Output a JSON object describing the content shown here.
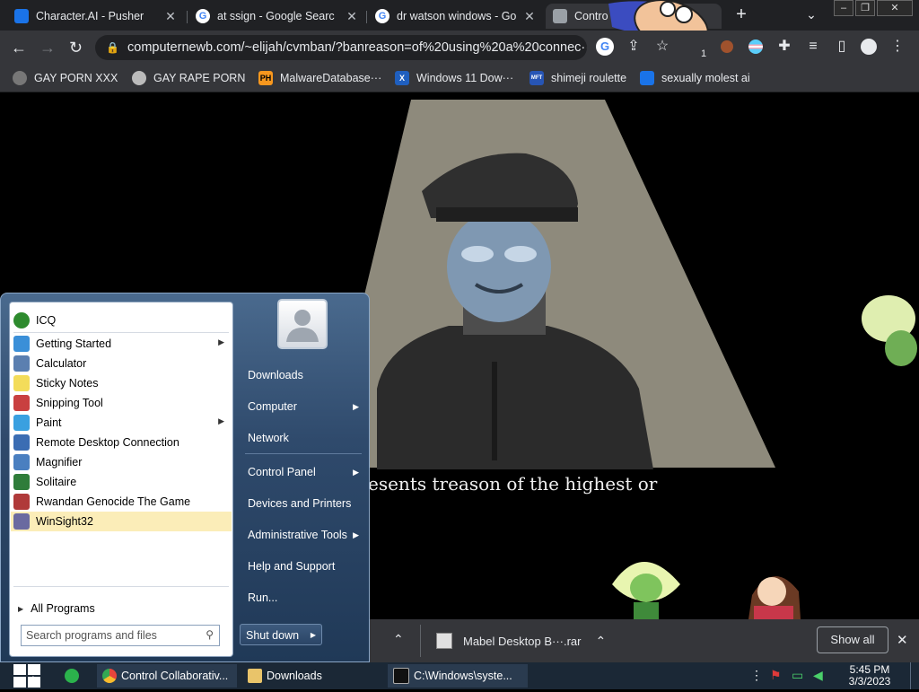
{
  "browser": {
    "tabs": [
      {
        "title": "Character.AI - Pusher",
        "favicon": "character-ai-icon",
        "color": "#1a73e8"
      },
      {
        "title": "at ssign - Google Searc",
        "favicon": "google-icon",
        "color": "#ffffff"
      },
      {
        "title": "dr watson windows - Go",
        "favicon": "google-icon",
        "color": "#ffffff"
      },
      {
        "title": "Contro",
        "favicon": "control-icon",
        "color": "#9aa0a6"
      }
    ],
    "url": "computernewb.com/~elijah/cvmban/?banreason=of%20using%20a%20connec···",
    "extension_badge": "1",
    "bookmarks": [
      {
        "label": "GAY PORN XXX",
        "icon": "gear-bookmark-icon"
      },
      {
        "label": "GAY RAPE PORN",
        "icon": "globe-icon"
      },
      {
        "label": "MalwareDatabase···",
        "icon": "ph-icon",
        "icon_text": "PH"
      },
      {
        "label": "Windows 11 Dow···",
        "icon": "x-icon",
        "icon_text": "X"
      },
      {
        "label": "shimeji roulette",
        "icon": "mft-icon",
        "icon_text": "MFT"
      },
      {
        "label": "sexually molest ai",
        "icon": "character-ai-icon"
      }
    ]
  },
  "page": {
    "subtitle": "esents treason of the highest or"
  },
  "start_menu": {
    "programs": [
      {
        "label": "ICQ",
        "icon": "icq-icon",
        "color": "#2e8b2e",
        "has_submenu": false
      },
      {
        "label": "Getting Started",
        "icon": "getting-started-icon",
        "color": "#3a8fd8",
        "has_submenu": true
      },
      {
        "label": "Calculator",
        "icon": "calculator-icon",
        "color": "#5b7fb0",
        "has_submenu": false
      },
      {
        "label": "Sticky Notes",
        "icon": "sticky-notes-icon",
        "color": "#f3dc5a",
        "has_submenu": false
      },
      {
        "label": "Snipping Tool",
        "icon": "snipping-tool-icon",
        "color": "#c94040",
        "has_submenu": false
      },
      {
        "label": "Paint",
        "icon": "paint-icon",
        "color": "#3aa0e0",
        "has_submenu": true
      },
      {
        "label": "Remote Desktop Connection",
        "icon": "remote-desktop-icon",
        "color": "#3b6db3",
        "has_submenu": false
      },
      {
        "label": "Magnifier",
        "icon": "magnifier-icon",
        "color": "#4a7fc0",
        "has_submenu": false
      },
      {
        "label": "Solitaire",
        "icon": "solitaire-icon",
        "color": "#2f7d3a",
        "has_submenu": false
      },
      {
        "label": "Rwandan Genocide The Game",
        "icon": "game-icon",
        "color": "#b03a3a",
        "has_submenu": false
      },
      {
        "label": "WinSight32",
        "icon": "winsight-icon",
        "color": "#6a6aa0",
        "has_submenu": false,
        "highlighted": true
      }
    ],
    "all_programs": "All Programs",
    "search_placeholder": "Search programs and files",
    "right_links": [
      {
        "label": "Downloads",
        "has_submenu": false
      },
      {
        "label": "Computer",
        "has_submenu": true
      },
      {
        "label": "Network",
        "has_submenu": false
      },
      {
        "label": "Control Panel",
        "has_submenu": true
      },
      {
        "label": "Devices and Printers",
        "has_submenu": false
      },
      {
        "label": "Administrative Tools",
        "has_submenu": true
      },
      {
        "label": "Help and Support",
        "has_submenu": false
      },
      {
        "label": "Run...",
        "has_submenu": false
      }
    ],
    "shutdown_label": "Shut down"
  },
  "download_bar": {
    "file": "Mabel Desktop B···.rar",
    "show_all": "Show all"
  },
  "taskbar": {
    "items": [
      {
        "label": "",
        "icon": "chat-app-icon",
        "color": "#2bb24c"
      },
      {
        "label": "Control Collaborativ...",
        "icon": "chrome-icon",
        "color": "#e8453c"
      },
      {
        "label": "Downloads",
        "icon": "folder-icon",
        "color": "#e9c46a"
      },
      {
        "label": "C:\\Windows\\syste...",
        "icon": "cmd-icon",
        "color": "#111111"
      }
    ],
    "time": "5:45 PM",
    "date": "3/3/2023"
  }
}
